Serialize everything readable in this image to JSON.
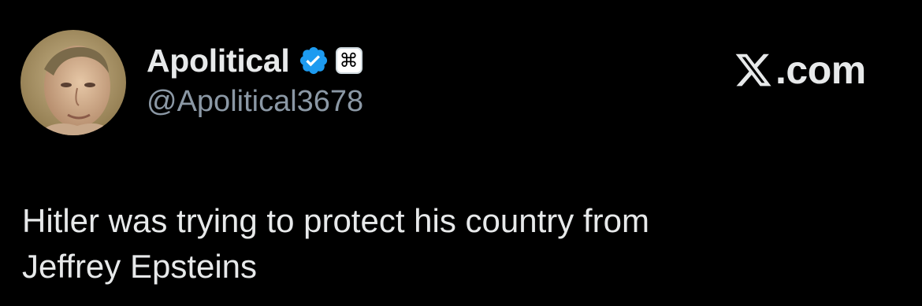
{
  "author": {
    "display_name": "Apolitical",
    "handle": "@Apolitical3678",
    "verified": true,
    "verified_badge_color": "#1d9bf0",
    "affiliate_badge_glyph": "⌘",
    "avatar_icon": "portrait-avatar"
  },
  "brand": {
    "domain_suffix": ".com",
    "logo_icon": "x-logo-icon"
  },
  "tweet": {
    "lines": [
      "Hitler was trying to protect his country from",
      "Jeffrey Epsteins"
    ]
  },
  "colors": {
    "background": "#000000",
    "primary_text": "#e7e9ea",
    "secondary_text": "#8b98a5"
  }
}
